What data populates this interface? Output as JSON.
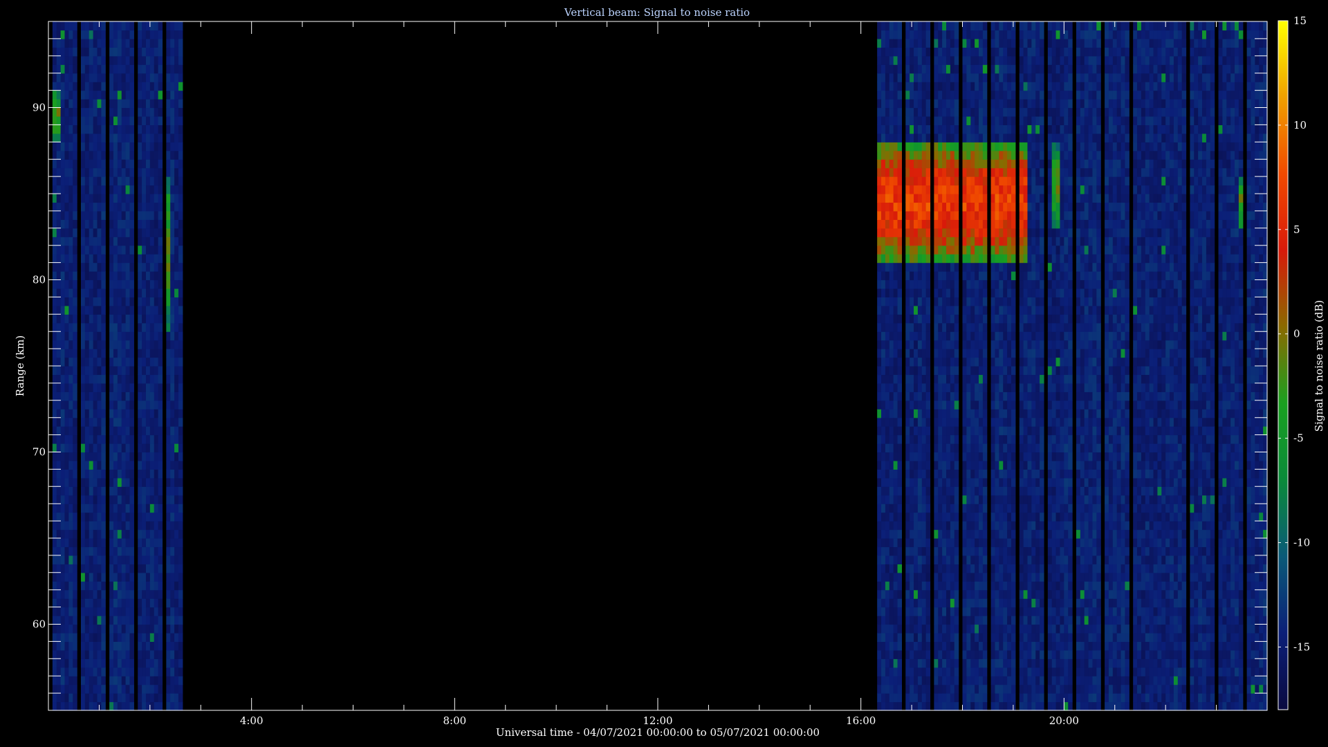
{
  "chart_data": {
    "type": "heatmap",
    "title": "Vertical beam: Signal to noise ratio",
    "xlabel": "Universal time - 04/07/2021 00:00:00 to 05/07/2021 00:00:00",
    "ylabel": "Range (km)",
    "colorbar_label": "Signal to noise ratio (dB)",
    "x_range_hours": [
      0,
      24
    ],
    "y_range_km": [
      55,
      95
    ],
    "x_ticks": [
      {
        "hour": 4,
        "label": "4:00"
      },
      {
        "hour": 8,
        "label": "8:00"
      },
      {
        "hour": 12,
        "label": "12:00"
      },
      {
        "hour": 16,
        "label": "16:00"
      },
      {
        "hour": 20,
        "label": "20:00"
      }
    ],
    "y_ticks": [
      {
        "km": 60,
        "label": "60"
      },
      {
        "km": 70,
        "label": "70"
      },
      {
        "km": 80,
        "label": "80"
      },
      {
        "km": 90,
        "label": "90"
      }
    ],
    "colorbar_range_db": [
      -18,
      15
    ],
    "colorbar_ticks": [
      {
        "db": 15,
        "label": "15"
      },
      {
        "db": 10,
        "label": "10"
      },
      {
        "db": 5,
        "label": "5"
      },
      {
        "db": 0,
        "label": "0"
      },
      {
        "db": -5,
        "label": "-5"
      },
      {
        "db": -10,
        "label": "-10"
      },
      {
        "db": -15,
        "label": "-15"
      }
    ],
    "colormap": [
      "#0a0a40",
      "#0b1f78",
      "#0a5a78",
      "#0a8a3a",
      "#1aa020",
      "#8a6a00",
      "#d81a0a",
      "#f04a00",
      "#f0a000",
      "#ffff00"
    ],
    "data_gap_hours": [
      2.6,
      16.3
    ],
    "noise_level_db": -15,
    "echo_regions": [
      {
        "t_start": 16.3,
        "t_end": 19.3,
        "range_top_km": 88,
        "range_bottom_km": 81,
        "peak_snr_db": 9
      },
      {
        "t_start": 19.8,
        "t_end": 19.9,
        "range_top_km": 88,
        "range_bottom_km": 83,
        "peak_snr_db": 0
      },
      {
        "t_start": 2.25,
        "t_end": 2.4,
        "range_top_km": 86,
        "range_bottom_km": 77,
        "peak_snr_db": 0
      },
      {
        "t_start": 0.0,
        "t_end": 0.25,
        "range_top_km": 91,
        "range_bottom_km": 88,
        "peak_snr_db": 0
      },
      {
        "t_start": 23.45,
        "t_end": 23.55,
        "range_top_km": 86,
        "range_bottom_km": 83,
        "peak_snr_db": 0
      }
    ]
  }
}
